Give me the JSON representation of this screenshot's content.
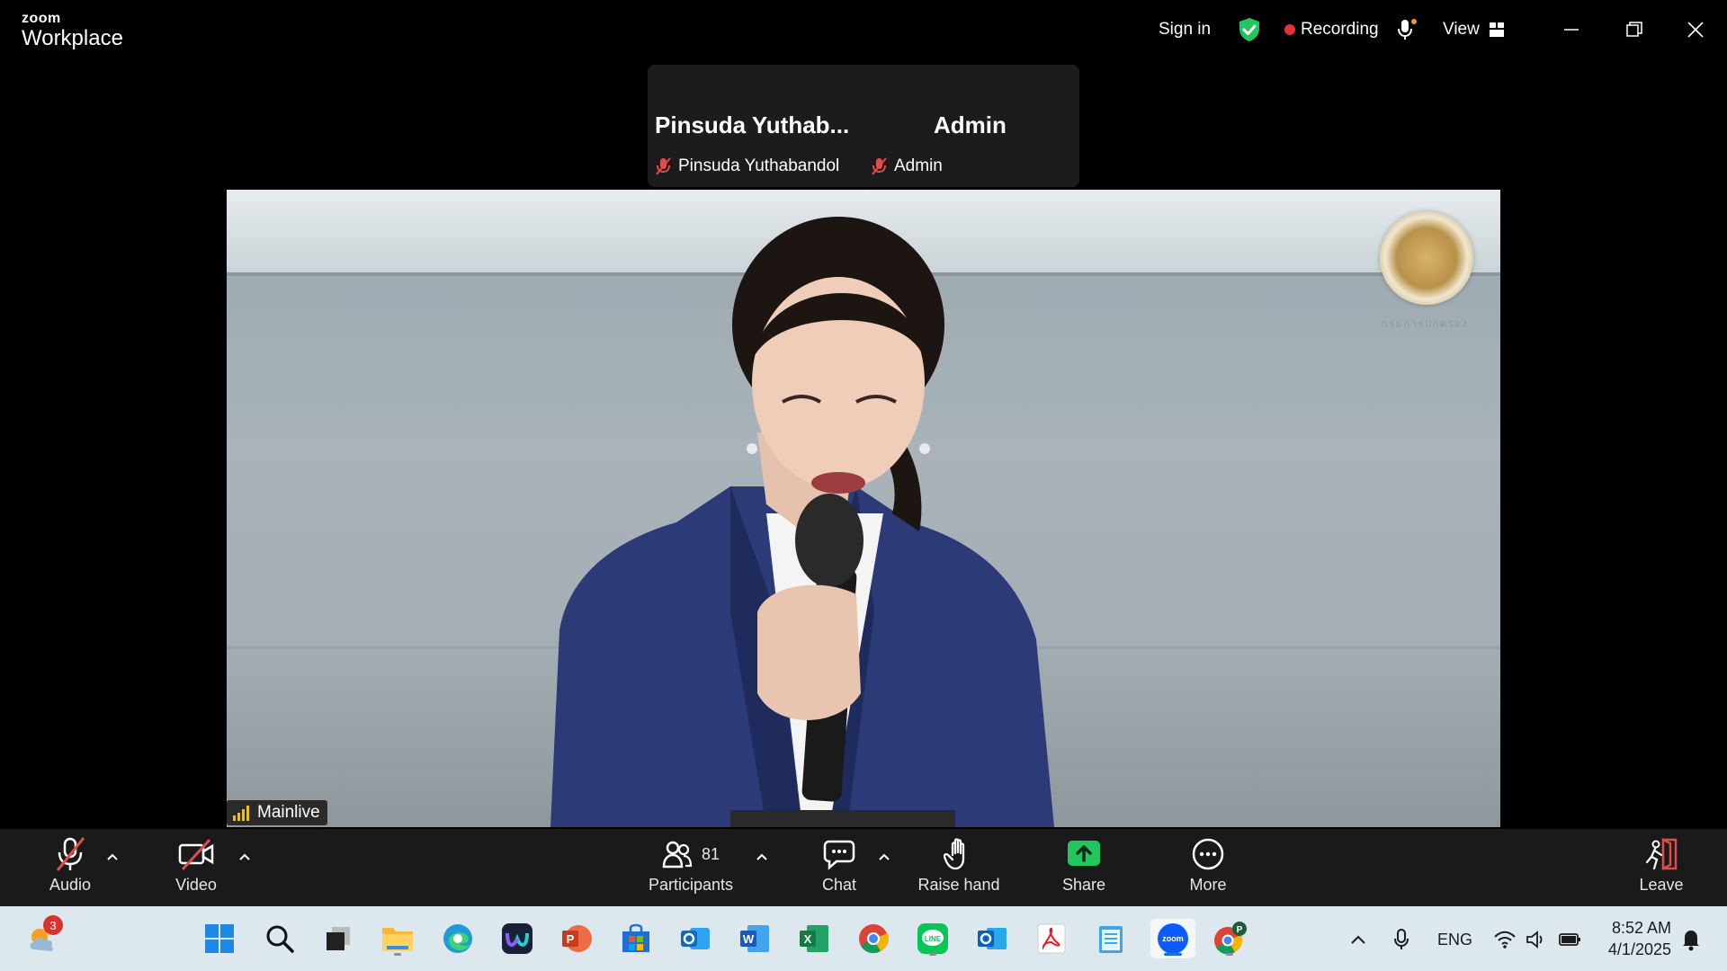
{
  "app": {
    "brand_small": "zoom",
    "brand_big": "Workplace"
  },
  "titlebar": {
    "sign_in": "Sign in",
    "recording": "Recording",
    "view": "View"
  },
  "thumbnails": [
    {
      "display_name": "Pinsuda  Yuthab...",
      "tag_name": "Pinsuda Yuthabandol"
    },
    {
      "display_name": "Admin",
      "tag_name": "Admin"
    }
  ],
  "video": {
    "stream_label": "Mainlive",
    "seal_caption": "กรมการปกครอง"
  },
  "controls": {
    "audio": "Audio",
    "video": "Video",
    "participants": "Participants",
    "participant_count": "81",
    "chat": "Chat",
    "raise_hand": "Raise hand",
    "share": "Share",
    "more": "More",
    "leave": "Leave"
  },
  "taskbar": {
    "weather_badge": "3",
    "language": "ENG",
    "time": "8:52 AM",
    "date": "4/1/2025",
    "apps": [
      "start",
      "search",
      "task-view",
      "file-explorer",
      "edge",
      "webex",
      "powerpoint",
      "store",
      "outlook-new",
      "word",
      "excel",
      "chrome",
      "line",
      "outlook",
      "acrobat",
      "notepad",
      "zoom",
      "chrome-profile"
    ]
  },
  "colors": {
    "accent_share": "#22c55e",
    "recording": "#e8303a",
    "shield": "#22c55e",
    "muted_red": "#e04b4b",
    "taskbar": "#dde7ee"
  }
}
